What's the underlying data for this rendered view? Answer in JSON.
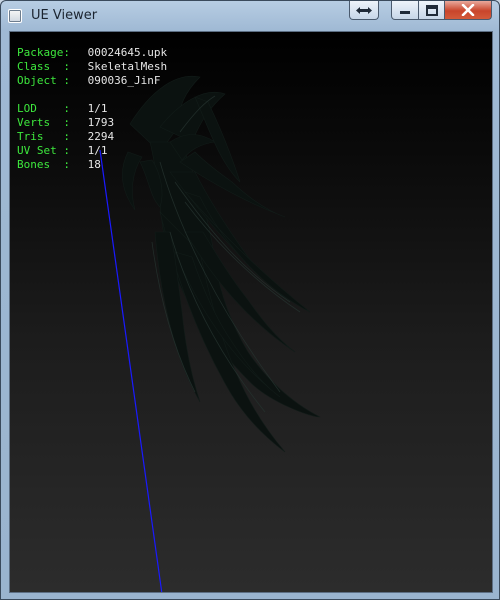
{
  "window": {
    "title": "UE Viewer"
  },
  "colors": {
    "label_green": "#3de83d",
    "value_white": "#e6e6e6",
    "axis_blue": "#1a1aff",
    "mesh_dark": "#0b1210"
  },
  "icons": {
    "app": "app-window-icon",
    "switch": "swap-arrows-icon",
    "minimize": "minimize-icon",
    "maximize": "maximize-icon",
    "close": "close-icon"
  },
  "info_block": {
    "package": {
      "label": "Package:",
      "value": "00024645.upk"
    },
    "class": {
      "label": "Class  :",
      "value": "SkeletalMesh"
    },
    "object": {
      "label": "Object :",
      "value": "090036_JinF"
    }
  },
  "mesh_stats": {
    "lod": {
      "label": "LOD    :",
      "value": "1/1"
    },
    "verts": {
      "label": "Verts  :",
      "value": "1793"
    },
    "tris": {
      "label": "Tris   :",
      "value": "2294"
    },
    "uv_set": {
      "label": "UV Set :",
      "value": "1/1"
    },
    "bones": {
      "label": "Bones  :",
      "value": "18"
    }
  }
}
